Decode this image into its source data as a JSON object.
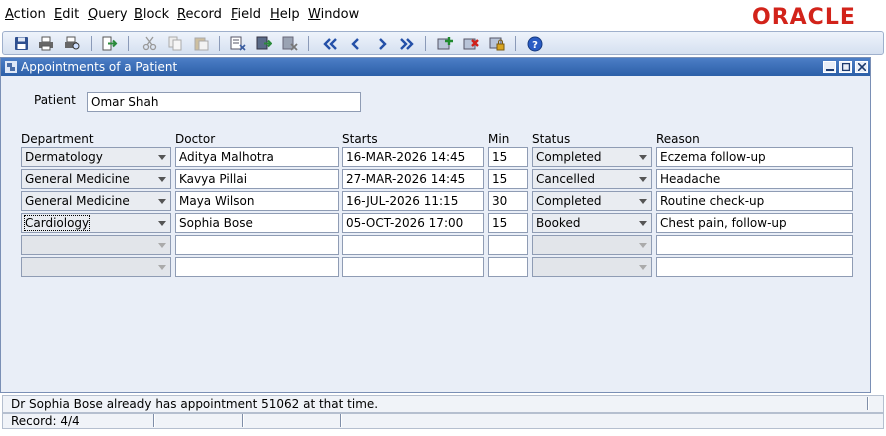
{
  "menu": [
    {
      "label": "Action",
      "u": "A",
      "rest": "ction"
    },
    {
      "label": "Edit",
      "u": "E",
      "rest": "dit"
    },
    {
      "label": "Query",
      "u": "Q",
      "rest": "uery"
    },
    {
      "label": "Block",
      "u": "B",
      "rest": "lock"
    },
    {
      "label": "Record",
      "u": "R",
      "rest": "ecord"
    },
    {
      "label": "Field",
      "u": "F",
      "rest": "ield"
    },
    {
      "label": "Help",
      "u": "H",
      "rest": "elp"
    },
    {
      "label": "Window",
      "u": "W",
      "rest": "indow"
    }
  ],
  "brand": {
    "logo_text": "ORACLE",
    "color": "#d2231a"
  },
  "toolbar_icons": [
    "save-icon",
    "print-icon",
    "print-preview-icon",
    "exit-icon",
    "cut-icon",
    "copy-icon",
    "paste-icon",
    "clear-form-icon",
    "execute-query-icon",
    "cancel-query-icon",
    "first-record-icon",
    "previous-record-icon",
    "next-record-icon",
    "last-record-icon",
    "insert-record-icon",
    "delete-record-icon",
    "lock-record-icon",
    "help-icon"
  ],
  "window": {
    "title": "Appointments of a Patient"
  },
  "patient": {
    "label": "Patient",
    "value": "Omar Shah"
  },
  "columns": {
    "department": "Department",
    "doctor": "Doctor",
    "starts": "Starts",
    "min": "Min",
    "status": "Status",
    "reason": "Reason"
  },
  "rows": [
    {
      "department": "Dermatology",
      "doctor": "Aditya Malhotra",
      "starts": "16-MAR-2026 14:45",
      "min": "15",
      "status": "Completed",
      "reason": "Eczema follow-up"
    },
    {
      "department": "General Medicine",
      "doctor": "Kavya Pillai",
      "starts": "27-MAR-2026 14:45",
      "min": "15",
      "status": "Cancelled",
      "reason": "Headache"
    },
    {
      "department": "General Medicine",
      "doctor": "Maya Wilson",
      "starts": "16-JUL-2026 11:15",
      "min": "30",
      "status": "Completed",
      "reason": "Routine check-up"
    },
    {
      "department": "Cardiology",
      "doctor": "Sophia Bose",
      "starts": "05-OCT-2026 17:00",
      "min": "15",
      "status": "Booked",
      "reason": "Chest pain, follow-up"
    },
    {
      "department": "",
      "doctor": "",
      "starts": "",
      "min": "",
      "status": "",
      "reason": ""
    },
    {
      "department": "",
      "doctor": "",
      "starts": "",
      "min": "",
      "status": "",
      "reason": ""
    }
  ],
  "status": {
    "message": "Dr Sophia Bose already has appointment 51062 at that time.",
    "record": "Record: 4/4"
  }
}
